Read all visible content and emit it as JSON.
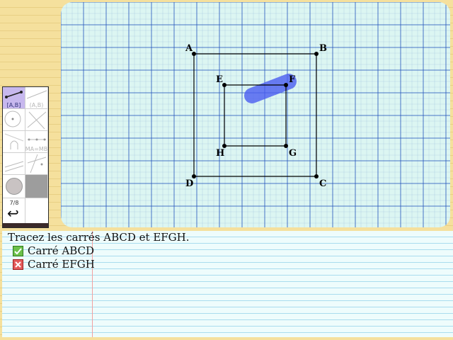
{
  "canvas": {
    "points": [
      {
        "name": "A",
        "label_pos": "top-left"
      },
      {
        "name": "B",
        "label_pos": "top-right"
      },
      {
        "name": "C",
        "label_pos": "bottom-right"
      },
      {
        "name": "D",
        "label_pos": "bottom-left"
      },
      {
        "name": "E",
        "label_pos": "top-left"
      },
      {
        "name": "F",
        "label_pos": "top-right"
      },
      {
        "name": "G",
        "label_pos": "bottom-right"
      },
      {
        "name": "H",
        "label_pos": "bottom-left"
      }
    ],
    "squares": [
      "ABCD",
      "EFGH"
    ],
    "colors": {
      "grid": "#1f4fb8",
      "background": "#dcf6f2",
      "stroke": "#000000",
      "highlight": "#4a5cf0"
    }
  },
  "palette": {
    "tools": [
      {
        "id": "segment",
        "label": "[A,B]",
        "active": true
      },
      {
        "id": "line",
        "label": "(A,B)",
        "active": false
      },
      {
        "id": "circle",
        "label": "",
        "active": false
      },
      {
        "id": "lines",
        "label": "",
        "active": false
      },
      {
        "id": "arc",
        "label": "",
        "active": false
      },
      {
        "id": "midpoint",
        "label": "MA=MB",
        "active": false
      },
      {
        "id": "perpendicular",
        "label": "",
        "active": false
      },
      {
        "id": "parallel",
        "label": "",
        "active": false
      },
      {
        "id": "color",
        "label": "",
        "active": false
      },
      {
        "id": "gray",
        "label": "",
        "active": false
      }
    ],
    "page_counter": "7/8",
    "undo_icon": "undo-arrow-icon"
  },
  "instructions": {
    "prompt": "Tracez les carrés ABCD et EFGH.",
    "tasks": [
      {
        "label": "Carré ABCD",
        "status": "done",
        "icon": "check-icon"
      },
      {
        "label": "Carré EFGH",
        "status": "failed",
        "icon": "cross-icon"
      }
    ]
  }
}
